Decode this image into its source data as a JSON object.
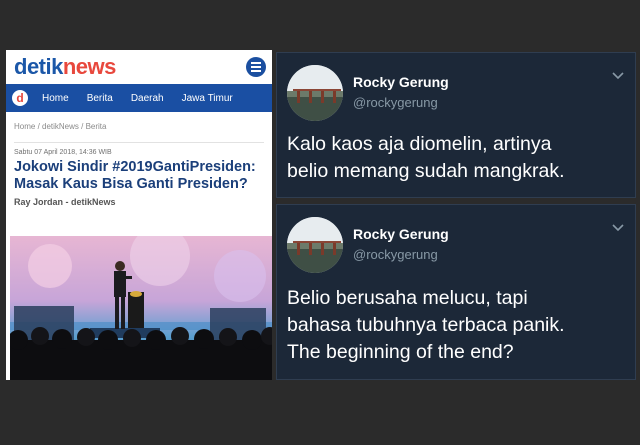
{
  "article": {
    "logo_part1": "detik",
    "logo_part2": "news",
    "nav_logo_letter": "d",
    "nav": [
      "Home",
      "Berita",
      "Daerah",
      "Jawa Timur"
    ],
    "breadcrumb": "Home / detikNews / Berita",
    "date": "Sabtu 07 April 2018, 14:36 WIB",
    "headline": "Jokowi Sindir #2019GantiPresiden: Masak Kaus Bisa Ganti Presiden?",
    "author": "Ray Jordan - detikNews",
    "colors": {
      "brand_blue": "#1a4fa3",
      "brand_red": "#e8483d",
      "headline": "#1b3f7a"
    }
  },
  "tweets": [
    {
      "name": "Rocky Gerung",
      "handle": "@rockygerung",
      "lines": [
        "Kalo kaos aja diomelin, artinya",
        "belio memang sudah mangkrak."
      ]
    },
    {
      "name": "Rocky Gerung",
      "handle": "@rockygerung",
      "lines": [
        "Belio berusaha melucu, tapi",
        "bahasa tubuhnya terbaca panik.",
        "The beginning of the end?"
      ]
    }
  ],
  "theme": {
    "tweet_bg": "#1c2838",
    "handle_color": "#8899a6",
    "page_bg": "#2b2b2b"
  }
}
